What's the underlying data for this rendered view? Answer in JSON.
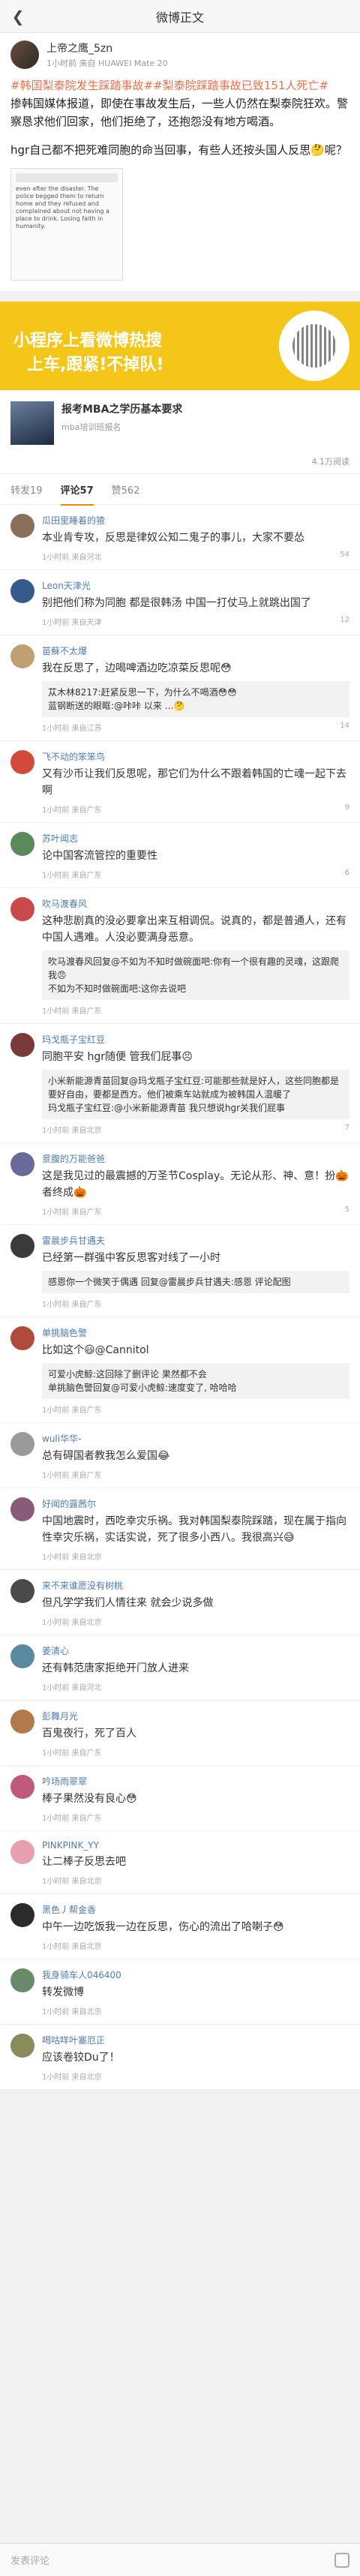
{
  "topbar": {
    "title": "微博正文"
  },
  "post": {
    "author": "上帝之鹰_5zn",
    "meta": "1小时前 来自 HUAWEI Mate 20",
    "topic": "#韩国梨泰院发生踩踏事故##梨泰院踩踏事故已致151人死亡#",
    "paragraph1": "掺韩国媒体报道，即使在事故发生后，一些人仍然在梨泰院狂欢。警察恳求他们回家，他们拒绝了，还抱怨没有地方喝酒。",
    "paragraph2": "hgr自己都不把死难同胞的命当回事，有些人还按头国人反思🤔呢？",
    "image_text": "even after the disaster. The police begged them to return home and they refused and complained about not having a place to drink. Losing faith in humanity.",
    "ad_line1": "小程序上看微博热搜",
    "ad_line2": "上车,跟紧!不掉队!"
  },
  "article": {
    "title": "报考MBA之学历基本要求",
    "subtitle": "mba培训班报名",
    "views": "4.1万阅读"
  },
  "tabs": {
    "repost": "转发19",
    "comment": "评论57",
    "like": "赞562"
  },
  "comments": [
    {
      "name": "瓜田里睡着的猹",
      "text": "本业肯专攻，反思是律奴公知二鬼子的事儿，大家不要怂",
      "time": "1小时前 来自河北",
      "likes": "54",
      "color": "#8a6f5a"
    },
    {
      "name": "Leon天津光",
      "text": "别把他们称为同胞 都是很韩汤 中国一打仗马上就跳出国了",
      "time": "1小时前 来自天津",
      "likes": "12",
      "color": "#355b8c"
    },
    {
      "name": "苗蘇不太爆",
      "text": "我在反思了，边喝啤酒边吃凉菜反思呢😳",
      "time": "1小时前 来自江苏",
      "likes": "14",
      "color": "#c0a070",
      "replies": [
        "苁木林8217:赶紧反思一下，为什么不喝酒😳😳",
        "蓝钢断送的眼眶:@咔咔 以来 …🤔"
      ]
    },
    {
      "name": "飞不动的笨笨鸟",
      "text": "又有沙币让我们反思呢，那它们为什么不跟着韩国的亡魂一起下去啊",
      "time": "1小时前 来自广东",
      "likes": "9",
      "color": "#d24a3a"
    },
    {
      "name": "苏叶闻志",
      "text": "论中国客流管控的重要性",
      "time": "1小时前 来自广东",
      "likes": "6",
      "color": "#5a8a5a"
    },
    {
      "name": "吹马渡春风",
      "text": "这种悲剧真的没必要拿出来互相调侃。说真的，都是普通人，还有中国人遇难。人没必要满身恶意。",
      "time": "1小时前 来自广东",
      "likes": "",
      "color": "#c84a4a",
      "replies": [
        "吹马渡春风回复@不如为不知时做碗面吧:你有一个很有趣的灵魂，这跟爬我😠",
        "不如为不知时做碗面吧:这你去说吧"
      ]
    },
    {
      "name": "玛戈瓶子宝红豆",
      "text": "同胞平安 hgr随便 管我们屁事😣",
      "time": "1小时前 来自北京",
      "likes": "7",
      "color": "#7a3a3a",
      "replies": [
        "小米新能源青苗回复@玛戈瓶子宝红豆:可能那些就是好人，这些同胞都是要好自由，要都是西方。他们被乘车站就成为被韩国人温暖了",
        "玛戈瓶子宝红豆:@小米新能源青苗 我只想说hgr关我们屁事"
      ]
    },
    {
      "name": "景腹的万能爸爸",
      "text": "这是我见过的最震撼的万圣节Cosplay。无论从形、神、意！扮🎃者终成🎃",
      "time": "1小时前 来自广东",
      "likes": "5",
      "color": "#6a6a9a"
    },
    {
      "name": "雷晨步兵甘遇夫",
      "text": "已经第一群强中客反思客对线了一小时",
      "time": "1小时前 来自广东",
      "likes": "",
      "color": "#3a3a3a",
      "replies": [
        "感恩你一个微笑于偶遇 回复@雷晨步兵甘遇夫:感恩 评论配图"
      ]
    },
    {
      "name": "单挑脑色警",
      "text": "比如这个😃@Cannitol",
      "time": "1小时前 来自广东",
      "likes": "",
      "color": "#b04a3a",
      "replies": [
        "可爱小虎鲸:这回除了删评论 果然都不会",
        "单挑脑色警回复@可爱小虎鲸:速度变了, 哈哈哈"
      ]
    },
    {
      "name": "wuli华华-",
      "text": "总有碍国者教我怎么爱国😂",
      "time": "1小时前 来自广东",
      "likes": "",
      "color": "#9a9a9a"
    },
    {
      "name": "好闻的露茜尔",
      "text": "中国地震时，西吃幸灾乐祸。我对韩国梨泰院踩踏，现在属于指向性幸灾乐祸，实话实说，死了很多小西八。我很高兴😅",
      "time": "1小时前 来自北京",
      "likes": "",
      "color": "#8a5a7a"
    },
    {
      "name": "来不来谁愿没有树桃",
      "text": "但凡学学我们人情往来 就会少说多做",
      "time": "1小时前 来自北京",
      "likes": "",
      "color": "#4a4a4a"
    },
    {
      "name": "姜清心",
      "text": "还有韩范唐家拒绝开门放人进来",
      "time": "1小时前 来自河北",
      "likes": "",
      "color": "#5a8aa0"
    },
    {
      "name": "彭舞月光",
      "text": "百鬼夜行，死了百人",
      "time": "1小时前 来自广东",
      "likes": "",
      "color": "#b07a4a"
    },
    {
      "name": "吟场雨翠翠",
      "text": "棒子果然没有良心😳",
      "time": "1小时前 来自广东",
      "likes": "",
      "color": "#c05a7a"
    },
    {
      "name": "PINKPINK_YY",
      "text": "让二棒子反思去吧",
      "time": "1小时前 来自北京",
      "likes": "",
      "color": "#e8a0b0"
    },
    {
      "name": "黑色丿帮金香",
      "text": "中午一边吃饭我一边在反思，伤心的流出了哈喇子😳",
      "time": "1小时前 来自北京",
      "likes": "",
      "color": "#2a2a2a"
    },
    {
      "name": "我身骑车人046400",
      "text": "转发微博",
      "time": "1小时前 来自北京",
      "likes": "",
      "color": "#6a8a6a"
    },
    {
      "name": "喝咕咩叶塞厄正",
      "text": "应该卷铰Du了！",
      "time": "1小时前 来自北京",
      "likes": "",
      "color": "#8a8a5a"
    }
  ],
  "bottom": {
    "placeholder": "发表评论"
  }
}
